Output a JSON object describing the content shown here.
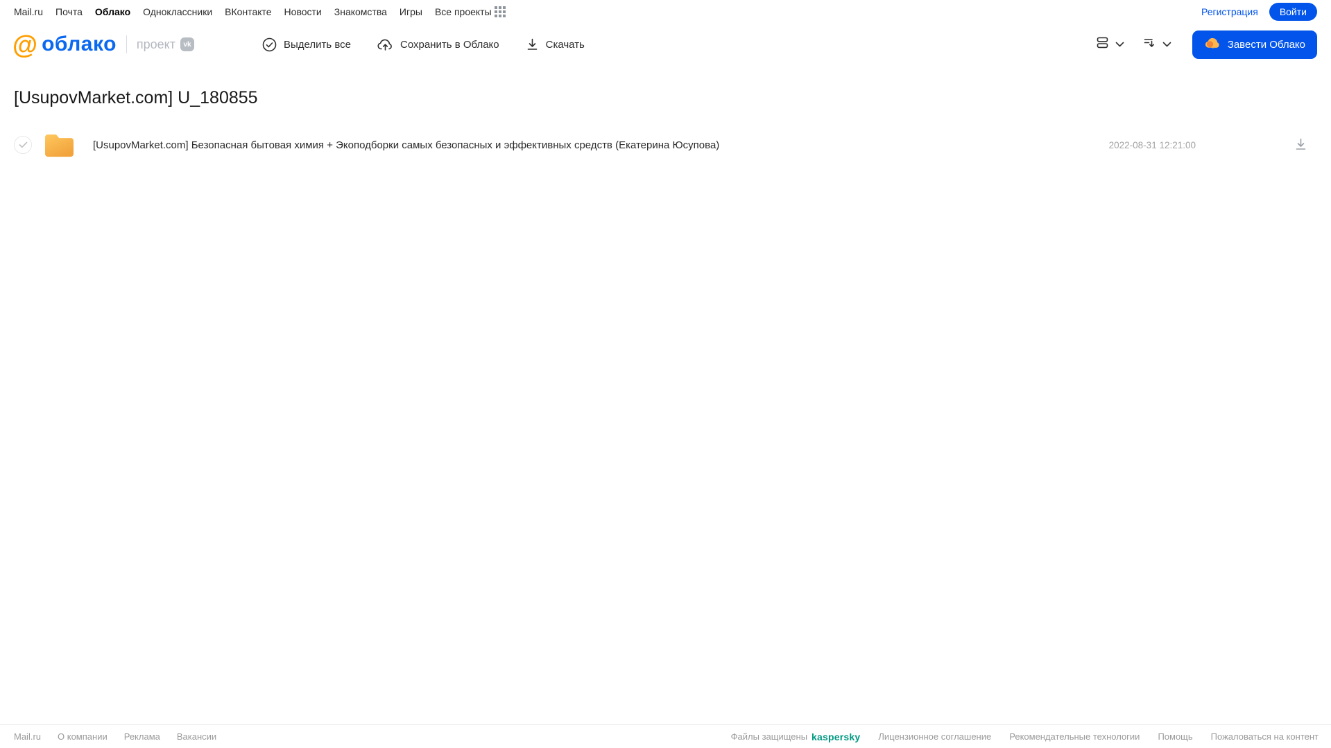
{
  "topnav": {
    "items": [
      "Mail.ru",
      "Почта",
      "Облако",
      "Одноклассники",
      "ВКонтакте",
      "Новости",
      "Знакомства",
      "Игры",
      "Все проекты"
    ],
    "active_item": "Облако",
    "register_label": "Регистрация",
    "login_label": "Войти"
  },
  "header": {
    "logo_at": "@",
    "logo_text": "облако",
    "project_label": "проект",
    "vk_badge": "vk",
    "actions": [
      {
        "label": "Выделить все",
        "icon": "check-circle-icon"
      },
      {
        "label": "Сохранить в Облако",
        "icon": "cloud-upload-icon"
      },
      {
        "label": "Скачать",
        "icon": "download-icon"
      }
    ],
    "cta_label": "Завести Облако"
  },
  "main": {
    "title": "[UsupovMarket.com] U_180855",
    "files": [
      {
        "type": "folder",
        "name": "[UsupovMarket.com] Безопасная бытовая химия + Экоподборки самых безопасных и эффективных средств (Екатерина Юсупова)",
        "date": "2022-08-31 12:21:00"
      }
    ]
  },
  "footer": {
    "left_links": [
      "Mail.ru",
      "О компании",
      "Реклама",
      "Вакансии"
    ],
    "protected_text": "Файлы защищены",
    "kaspersky_label": "kaspersky",
    "right_links": [
      "Лицензионное соглашение",
      "Рекомендательные технологии",
      "Помощь",
      "Пожаловаться на контент"
    ]
  },
  "colors": {
    "accent_blue": "#0254eb",
    "logo_blue": "#0b69f0",
    "logo_orange": "#ff9e00",
    "folder_top": "#ffc85f",
    "folder_bottom": "#f2a33c",
    "kaspersky_green": "#009982"
  }
}
